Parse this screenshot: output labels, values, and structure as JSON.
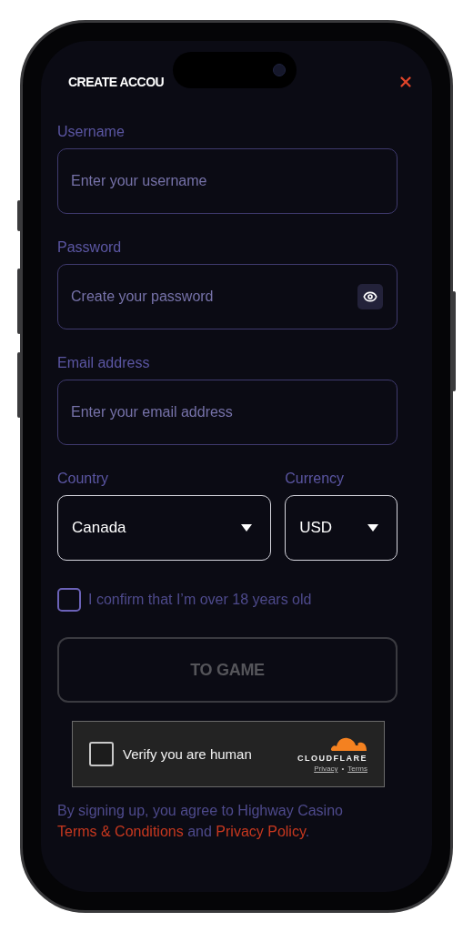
{
  "header": {
    "title": "CREATE ACCOU"
  },
  "fields": [
    {
      "kind": "text",
      "label": "Username",
      "placeholder": "Enter your username"
    },
    {
      "kind": "password",
      "label": "Password",
      "placeholder": "Create your password"
    },
    {
      "kind": "text",
      "label": "Email address",
      "placeholder": "Enter your email address"
    }
  ],
  "selects": [
    {
      "label": "Country",
      "value": "Canada"
    },
    {
      "label": "Currency",
      "value": "USD"
    }
  ],
  "age_check": {
    "label": "I confirm that I’m over 18 years old",
    "checked": false
  },
  "submit": {
    "label": "TO GAME",
    "disabled": true
  },
  "captcha": {
    "label": "Verify you are human",
    "checked": false,
    "brand": "CLOUDFLARE",
    "links": [
      "Privacy",
      "Terms"
    ],
    "separator": "•"
  },
  "legal": {
    "text": "By signing up, you agree to Highway Casino",
    "links": [
      "Terms & Conditions",
      "Privacy Policy"
    ],
    "joiner": "and",
    "end": "."
  }
}
